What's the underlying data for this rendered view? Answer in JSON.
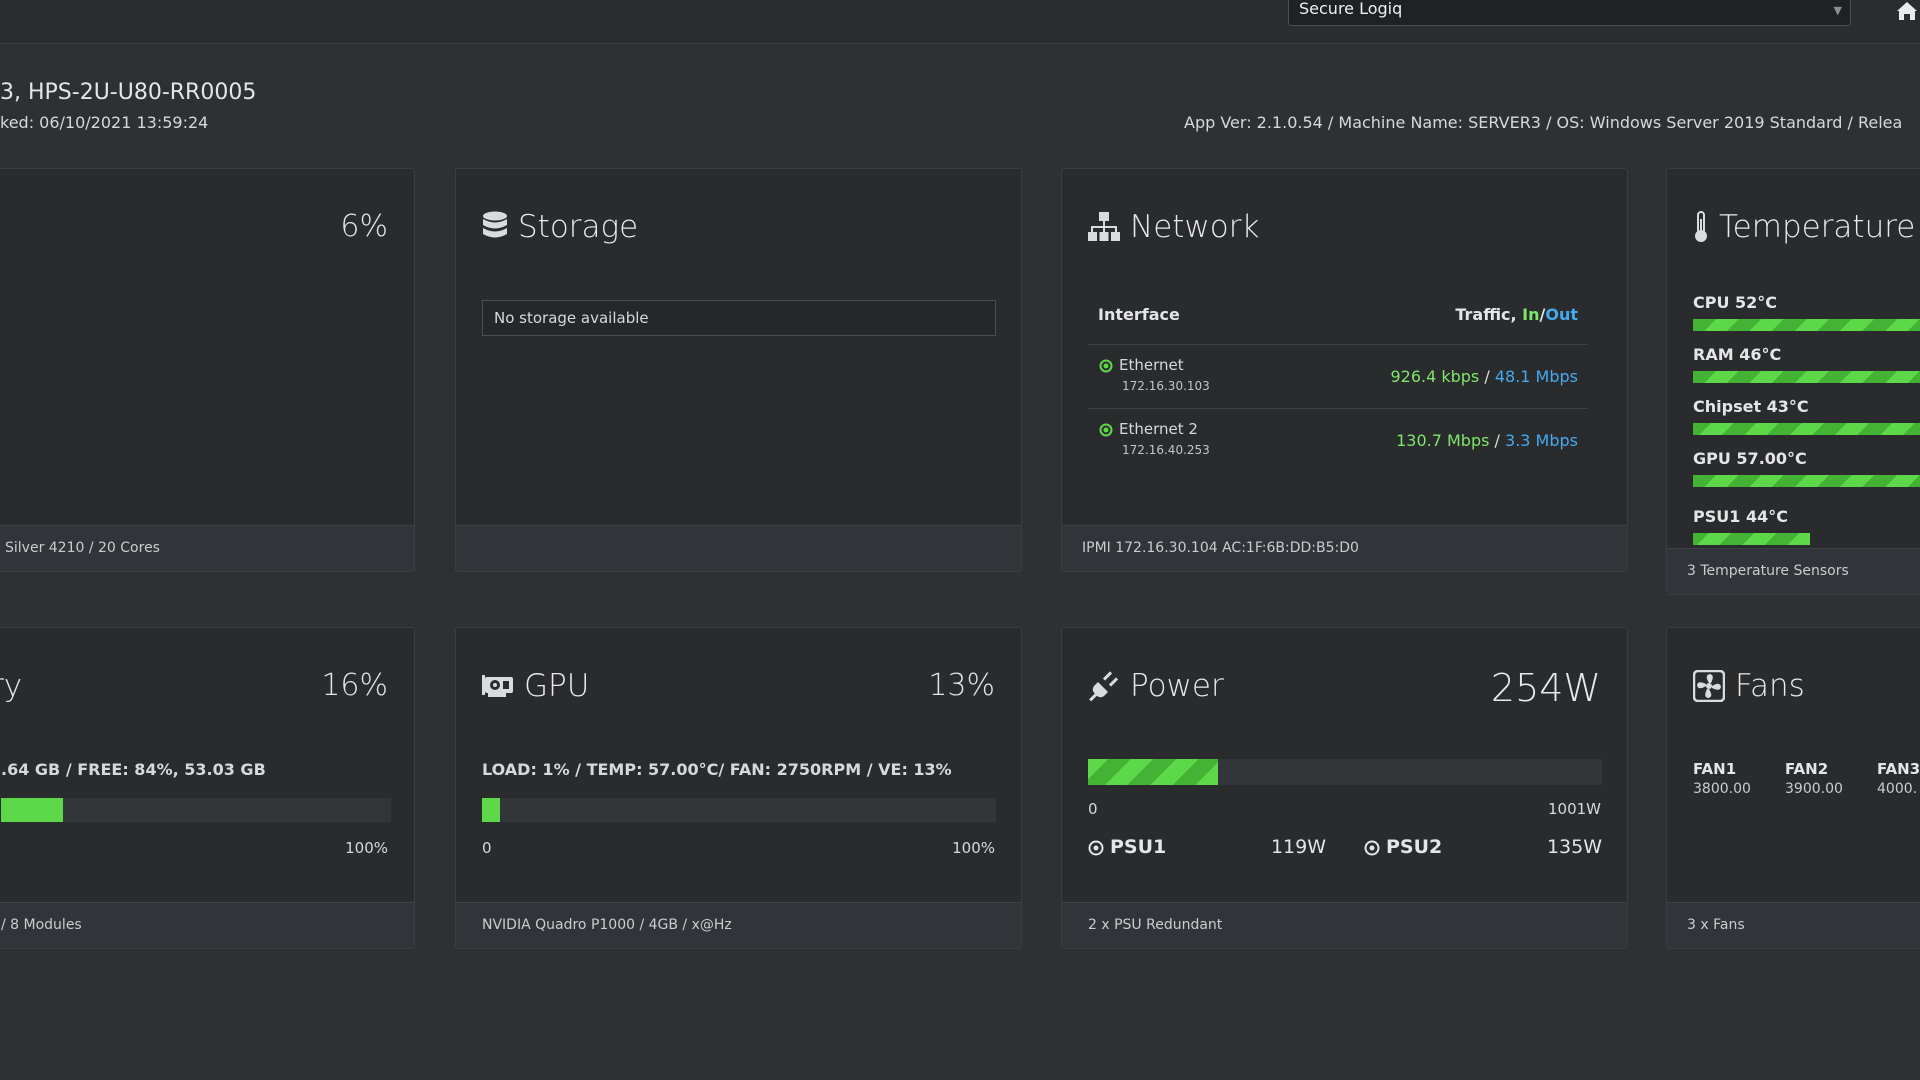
{
  "topbar": {
    "selector_value": "Secure Logiq",
    "home_icon": "home-icon"
  },
  "server": {
    "title": "3, HPS-2U-U80-RR0005",
    "checked": "ked: 06/10/2021 13:59:24",
    "app_info": "App Ver: 2.1.0.54 / Machine Name: SERVER3 / OS: Windows Server 2019 Standard / Relea"
  },
  "cpu": {
    "pct": "6%",
    "big_value": "6",
    "big_unit": "%",
    "level": 6,
    "footer": "Silver 4210 / 20 Cores"
  },
  "storage": {
    "title": "Storage",
    "icon": "database-icon",
    "message": "No storage available",
    "footer": ""
  },
  "network": {
    "title": "Network",
    "icon": "sitemap-icon",
    "col_interface": "Interface",
    "col_traffic": "Traffic, ",
    "col_in": "In",
    "col_sep": "/",
    "col_out": "Out",
    "rows": [
      {
        "name": "Ethernet",
        "ip": "172.16.30.103",
        "in": "926.4 kbps",
        "sep": " / ",
        "out": "48.1 Mbps"
      },
      {
        "name": "Ethernet 2",
        "ip": "172.16.40.253",
        "in": "130.7 Mbps",
        "sep": " / ",
        "out": "3.3 Mbps"
      }
    ],
    "footer": "IPMI 172.16.30.104 AC:1F:6B:DD:B5:D0"
  },
  "temperature": {
    "title": "Temperature",
    "icon": "thermometer-icon",
    "sensors": [
      {
        "label": "CPU 52°C",
        "level": 1.0
      },
      {
        "label": "RAM 46°C",
        "level": 1.0
      },
      {
        "label": "Chipset 43°C",
        "level": 0.98
      },
      {
        "label": "GPU 57.00°C",
        "level": 1.0
      },
      {
        "label": "PSU1 44°C",
        "level": 0.45
      }
    ],
    "footer": "3 Temperature Sensors"
  },
  "memory": {
    "title": "ry",
    "pct": "16%",
    "detail": ".64 GB / FREE: 84%, 53.03 GB",
    "level": 16,
    "max_label": "100%",
    "footer": "/ 8 Modules"
  },
  "gpu": {
    "title": "GPU",
    "icon": "gpu-card-icon",
    "pct": "13%",
    "detail": "LOAD: 1% / TEMP: 57.00°C/ FAN: 2750RPM / VE: 13%",
    "level": 1,
    "min_label": "0",
    "max_label": "100%",
    "footer": "NVIDIA Quadro P1000 / 4GB / x@Hz"
  },
  "power": {
    "title": "Power",
    "icon": "plug-icon",
    "value": "254W",
    "level_watts": 254,
    "max_watts": 1001,
    "min_label": "0",
    "max_label": "1001W",
    "psus": [
      {
        "name": "PSU1",
        "value": "119W"
      },
      {
        "name": "PSU2",
        "value": "135W"
      }
    ],
    "footer": "2 x PSU Redundant"
  },
  "fans": {
    "title": "Fans",
    "icon": "fan-icon",
    "items": [
      {
        "name": "FAN1",
        "value": "3800.00"
      },
      {
        "name": "FAN2",
        "value": "3900.00"
      },
      {
        "name": "FAN3",
        "value": "4000."
      }
    ],
    "footer": "3 x Fans"
  },
  "colors": {
    "accent_green": "#5cd849",
    "accent_blue": "#44aaee",
    "background": "#2e3134",
    "card": "#2a2b2d"
  }
}
